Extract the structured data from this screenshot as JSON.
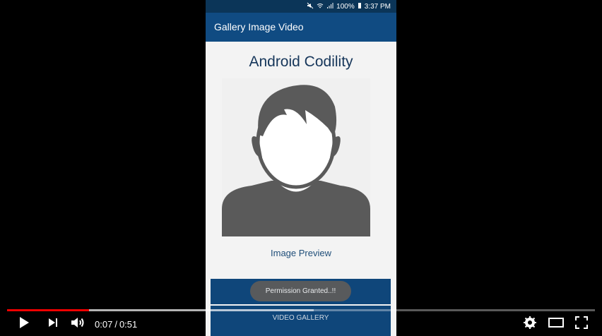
{
  "status": {
    "battery": "100%",
    "time": "3:37 PM"
  },
  "app": {
    "title": "Gallery Image Video"
  },
  "content": {
    "heading": "Android Codility",
    "preview_label": "Image Preview",
    "video_gallery": "VIDEO GALLERY",
    "toast": "Permission Granted..!!"
  },
  "player": {
    "current": "0:07",
    "duration": "0:51",
    "progress_fraction": 0.137
  }
}
